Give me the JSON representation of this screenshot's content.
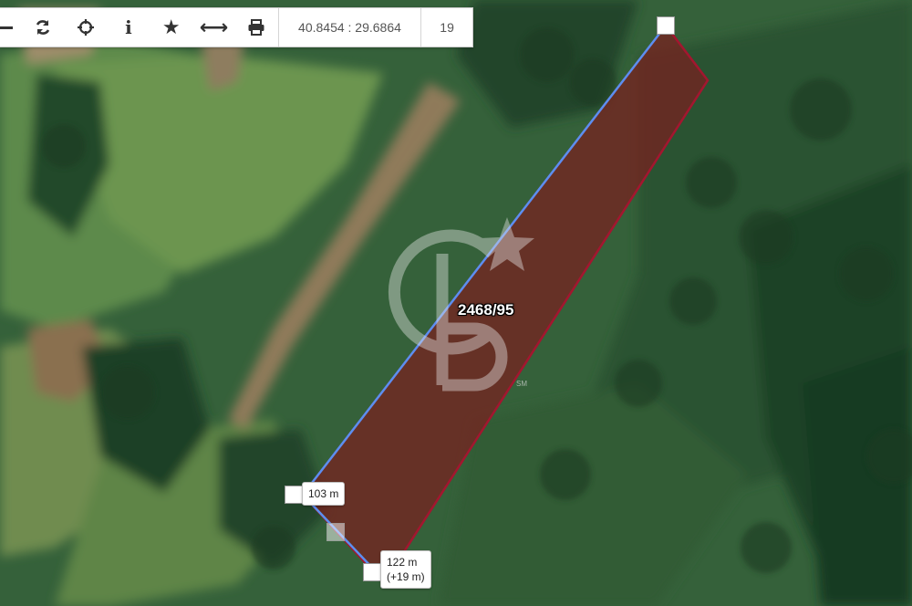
{
  "toolbar": {
    "buttons": [
      {
        "name": "zoom-out-button",
        "icon": "minus-icon",
        "glyph": "−"
      },
      {
        "name": "refresh-button",
        "icon": "refresh-icon",
        "glyph": ""
      },
      {
        "name": "locate-button",
        "icon": "crosshair-icon",
        "glyph": ""
      },
      {
        "name": "info-button",
        "icon": "info-icon",
        "glyph": "i"
      },
      {
        "name": "favorite-button",
        "icon": "star-icon",
        "glyph": "★"
      },
      {
        "name": "measure-button",
        "icon": "arrows-horizontal-icon",
        "glyph": "⟷"
      },
      {
        "name": "print-button",
        "icon": "printer-icon",
        "glyph": ""
      }
    ],
    "coordinates": "40.8454 : 29.6864",
    "zoom": "19"
  },
  "map": {
    "type": "satellite",
    "parcel": {
      "label": "2468/95",
      "fill_color": "#7a1e1e",
      "border_color": "#a3162f",
      "measured_edge_color": "#5b8ff0"
    },
    "measurements": {
      "segment_1": "103 m",
      "segment_2_line1": "122 m",
      "segment_2_line2": "(+19 m)"
    },
    "watermark": {
      "text": "CB",
      "mark": "SM"
    }
  }
}
